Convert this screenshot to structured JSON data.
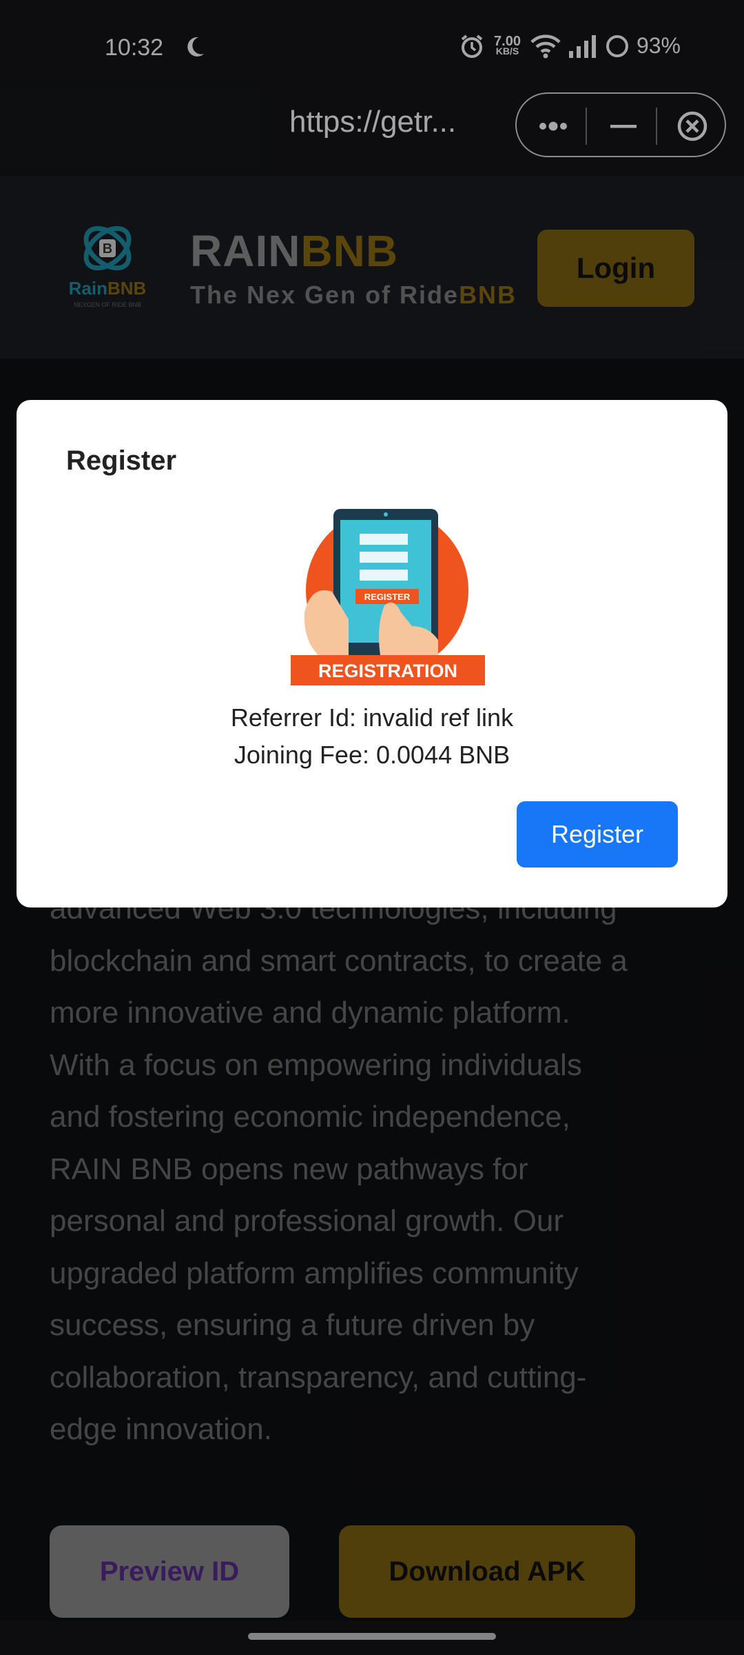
{
  "status_bar": {
    "time": "10:32",
    "network_speed_value": "7.00",
    "network_speed_unit": "KB/S",
    "battery": "93%",
    "icons": [
      "moon-icon",
      "alarm-icon",
      "wifi-icon",
      "signal-icon",
      "battery-icon"
    ]
  },
  "browser": {
    "url": "https://getr...",
    "buttons": [
      "more-icon",
      "minimize-icon",
      "close-icon"
    ]
  },
  "header": {
    "logo_text_primary": "Rain",
    "logo_text_accent": "BNB",
    "logo_tagline": "NEXGEN OF RIDE BNB",
    "brand_primary": "RAIN",
    "brand_accent": "BNB",
    "subtitle_primary": "The Nex Gen of Ride",
    "subtitle_accent": "BNB",
    "login_label": "Login",
    "brand_colors": {
      "accent": "#8b6a10",
      "muted": "#8f8f8f"
    }
  },
  "body": {
    "paragraph_lines": [
      "advanced Web 3.0 technologies, including",
      "blockchain and smart contracts, to create a",
      "more innovative and dynamic platform.",
      "With a focus on empowering individuals",
      "and fostering economic independence,",
      "RAIN BNB opens new pathways for",
      "personal and professional growth. Our",
      "upgraded platform amplifies community",
      "success, ensuring a future driven by",
      "collaboration, transparency, and cutting-",
      "edge innovation."
    ],
    "preview_button": "Preview ID",
    "download_button": "Download APK"
  },
  "modal": {
    "title": "Register",
    "illustration_button_text": "REGISTER",
    "illustration_banner_text": "REGISTRATION",
    "referrer_line": "Referrer Id: invalid ref link",
    "fee_line": "Joining Fee: 0.0044 BNB",
    "register_button": "Register",
    "button_color": "#1877f6"
  }
}
